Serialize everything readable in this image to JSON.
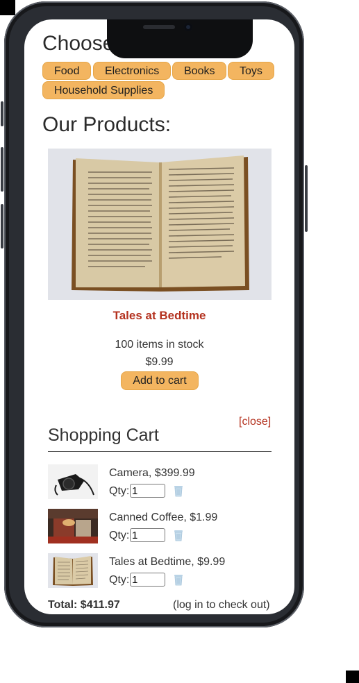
{
  "categories": {
    "heading": "Choose a Category:",
    "items": [
      "Food",
      "Electronics",
      "Books",
      "Toys",
      "Household Supplies"
    ]
  },
  "products": {
    "heading": "Our Products:",
    "item": {
      "name": "Tales at Bedtime",
      "stock": "100 items in stock",
      "price": "$9.99",
      "add_label": "Add to cart",
      "image_icon": "open-book-photo"
    }
  },
  "cart": {
    "close_label": "[close]",
    "title": "Shopping Cart",
    "qty_label": "Qty:",
    "items": [
      {
        "label": "Camera, $399.99",
        "qty": "1",
        "thumb_icon": "camera-photo"
      },
      {
        "label": "Canned Coffee, $1.99",
        "qty": "1",
        "thumb_icon": "coffee-photo"
      },
      {
        "label": "Tales at Bedtime, $9.99",
        "qty": "1",
        "thumb_icon": "book-photo"
      }
    ],
    "total": "Total: $411.97",
    "checkout_note": "(log in to check out)"
  },
  "colors": {
    "accent_button": "#f3b560",
    "link_red": "#b4321f",
    "phone_frame": "#2a2d33"
  }
}
